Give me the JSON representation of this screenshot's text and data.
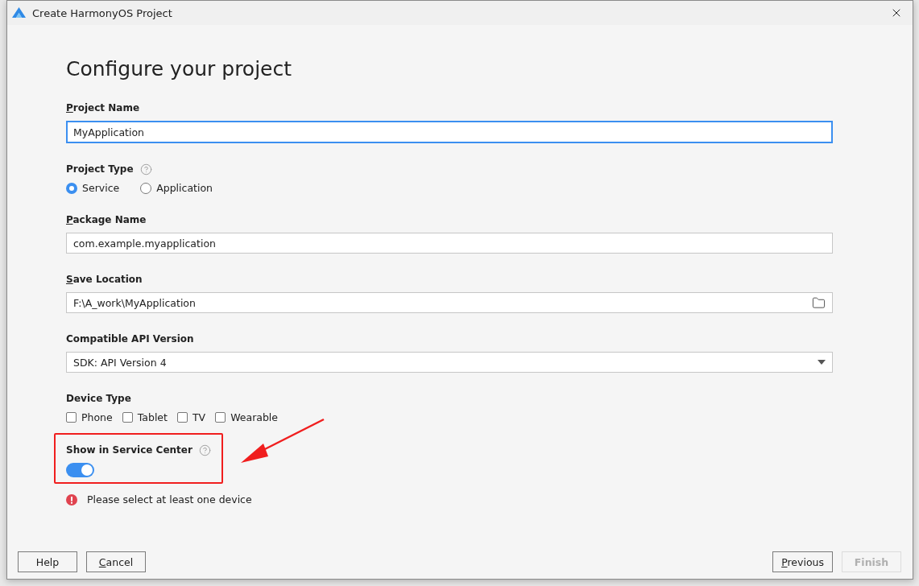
{
  "window": {
    "title": "Create HarmonyOS Project"
  },
  "heading": "Configure your project",
  "fields": [
    {
      "kind": "text",
      "label": "Project Name",
      "mnemonic": true,
      "help": false,
      "value": "MyApplication",
      "focused": true
    },
    {
      "kind": "radio",
      "label": "Project Type",
      "mnemonic": false,
      "help": true,
      "options": [
        {
          "label": "Service",
          "selected": true
        },
        {
          "label": "Application",
          "selected": false
        }
      ]
    },
    {
      "kind": "text",
      "label": "Package Name",
      "mnemonic": true,
      "help": false,
      "value": "com.example.myapplication",
      "focused": false
    },
    {
      "kind": "folder",
      "label": "Save Location",
      "mnemonic": true,
      "help": false,
      "value": "F:\\A_work\\MyApplication",
      "focused": false
    },
    {
      "kind": "select",
      "label": "Compatible API Version",
      "mnemonic": false,
      "help": false,
      "value": "SDK: API Version 4"
    },
    {
      "kind": "checkbox",
      "label": "Device Type",
      "mnemonic": false,
      "help": false,
      "options": [
        {
          "label": "Phone",
          "checked": false
        },
        {
          "label": "Tablet",
          "checked": false
        },
        {
          "label": "TV",
          "checked": false
        },
        {
          "label": "Wearable",
          "checked": false
        }
      ]
    },
    {
      "kind": "toggle",
      "label": "Show in Service Center",
      "mnemonic": false,
      "help": true,
      "on": true,
      "highlighted": true
    }
  ],
  "error": "Please select at least one device",
  "buttons_left": [
    {
      "label": "Help",
      "mnemonic": false,
      "disabled": false
    },
    {
      "label": "Cancel",
      "mnemonic": true,
      "disabled": false
    }
  ],
  "buttons_right": [
    {
      "label": "Previous",
      "mnemonic": true,
      "disabled": false
    },
    {
      "label": "Finish",
      "mnemonic": false,
      "disabled": true
    }
  ]
}
